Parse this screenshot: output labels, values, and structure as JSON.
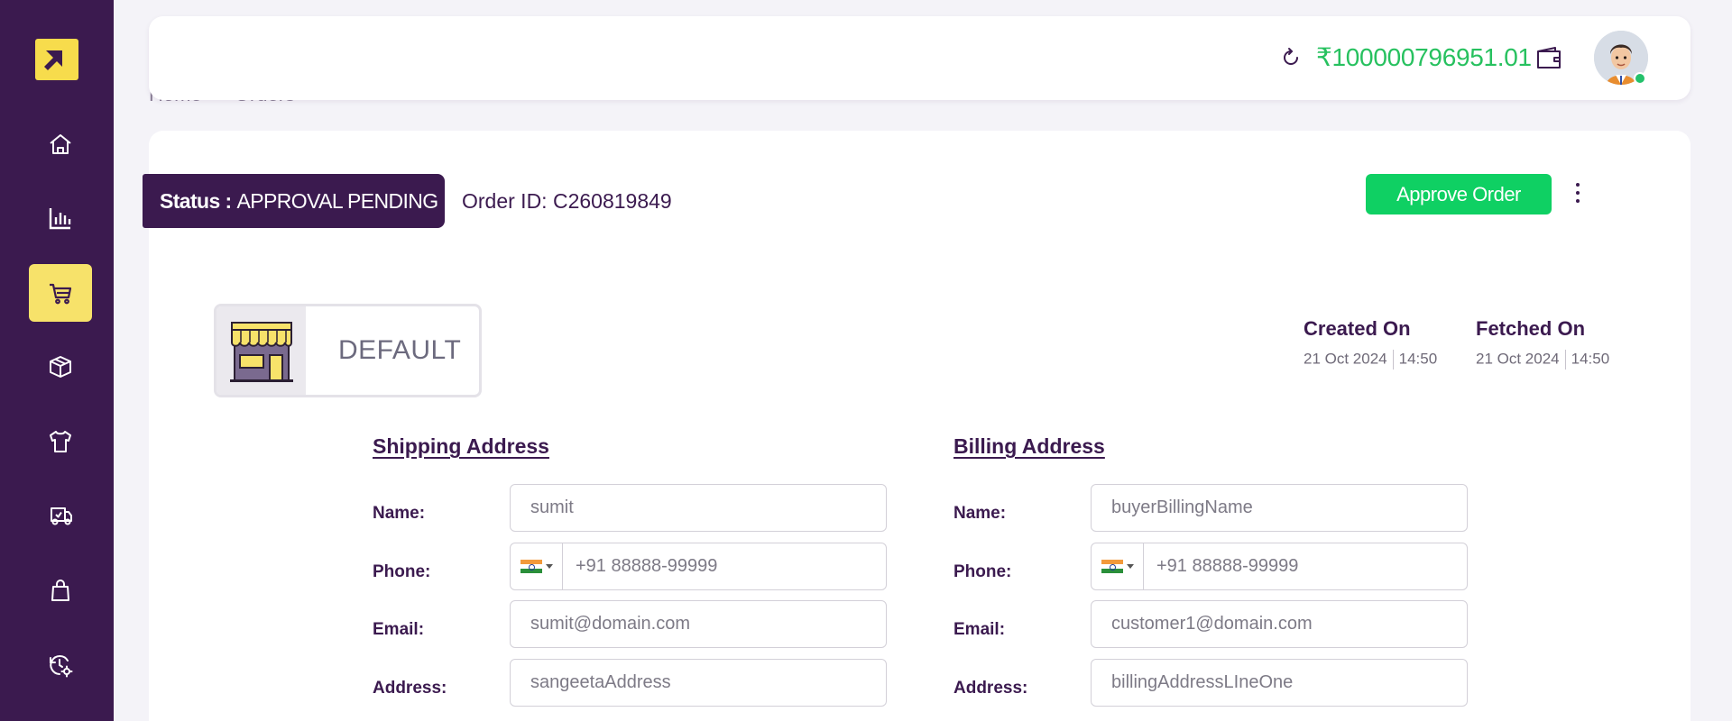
{
  "sidebar": {
    "items": [
      {
        "name": "home",
        "icon": "home-icon"
      },
      {
        "name": "analytics",
        "icon": "bar-chart-icon"
      },
      {
        "name": "orders",
        "icon": "cart-icon",
        "active": true
      },
      {
        "name": "inventory",
        "icon": "box-icon"
      },
      {
        "name": "products",
        "icon": "tshirt-icon"
      },
      {
        "name": "shipping",
        "icon": "truck-icon"
      },
      {
        "name": "purchases",
        "icon": "bag-icon"
      },
      {
        "name": "settings",
        "icon": "clock-gear-icon"
      }
    ]
  },
  "breadcrumb": [
    "Home",
    "Orders"
  ],
  "header": {
    "balance": "₹100000796951.01"
  },
  "order": {
    "status_label": "Status :",
    "status_value": "APPROVAL PENDING",
    "order_id_label": "Order ID:",
    "order_id_value": "C260819849",
    "approve_label": "Approve Order",
    "store_name": "DEFAULT",
    "created_label": "Created On",
    "created_date": "21 Oct 2024",
    "created_time": "14:50",
    "fetched_label": "Fetched On",
    "fetched_date": "21 Oct 2024",
    "fetched_time": "14:50"
  },
  "shipping": {
    "title": "Shipping Address",
    "name_label": "Name:",
    "name": "sumit",
    "phone_label": "Phone:",
    "phone": "+91 88888-99999",
    "email_label": "Email:",
    "email": "sumit@domain.com",
    "address_label": "Address:",
    "address": "sangeetaAddress"
  },
  "billing": {
    "title": "Billing Address",
    "name_label": "Name:",
    "name": "buyerBillingName",
    "phone_label": "Phone:",
    "phone": "+91 88888-99999",
    "email_label": "Email:",
    "email": "customer1@domain.com",
    "address_label": "Address:",
    "address": "billingAddressLIneOne"
  },
  "colors": {
    "sidebar": "#3b1a4f",
    "accent_yellow": "#f7e26a",
    "balance_green": "#27c15f",
    "approve_green": "#0fd063"
  }
}
